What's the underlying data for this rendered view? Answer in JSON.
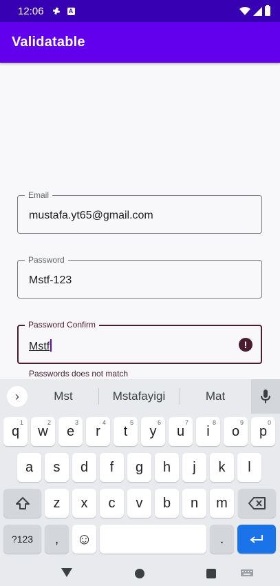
{
  "status_bar": {
    "time": "12:06",
    "a_badge": "A"
  },
  "app_bar": {
    "title": "Validatable"
  },
  "form": {
    "email": {
      "label": "Email",
      "value": "mustafa.yt65@gmail.com"
    },
    "password": {
      "label": "Password",
      "value": "Mstf-123"
    },
    "password_confirm": {
      "label": "Password Confirm",
      "value": "Mstf"
    },
    "error_text": "Passwords does not match"
  },
  "keyboard": {
    "expand_label": "›",
    "suggestions": [
      "Mst",
      "Mstafayigi",
      "Mat"
    ],
    "row1": [
      {
        "k": "q",
        "h": "1"
      },
      {
        "k": "w",
        "h": "2"
      },
      {
        "k": "e",
        "h": "3"
      },
      {
        "k": "r",
        "h": "4"
      },
      {
        "k": "t",
        "h": "5"
      },
      {
        "k": "y",
        "h": "6"
      },
      {
        "k": "u",
        "h": "7"
      },
      {
        "k": "i",
        "h": "8"
      },
      {
        "k": "o",
        "h": "9"
      },
      {
        "k": "p",
        "h": "0"
      }
    ],
    "row2": [
      "a",
      "s",
      "d",
      "f",
      "g",
      "h",
      "j",
      "k",
      "l"
    ],
    "row3": [
      "z",
      "x",
      "c",
      "v",
      "b",
      "n",
      "m"
    ],
    "symbols_label": "?123",
    "comma_label": ",",
    "emoji_label": "☺",
    "period_label": "."
  },
  "colors": {
    "status_bar": "#3700b3",
    "app_bar": "#6200ee",
    "error": "#4a1c2f",
    "enter_key": "#1a73e8"
  }
}
